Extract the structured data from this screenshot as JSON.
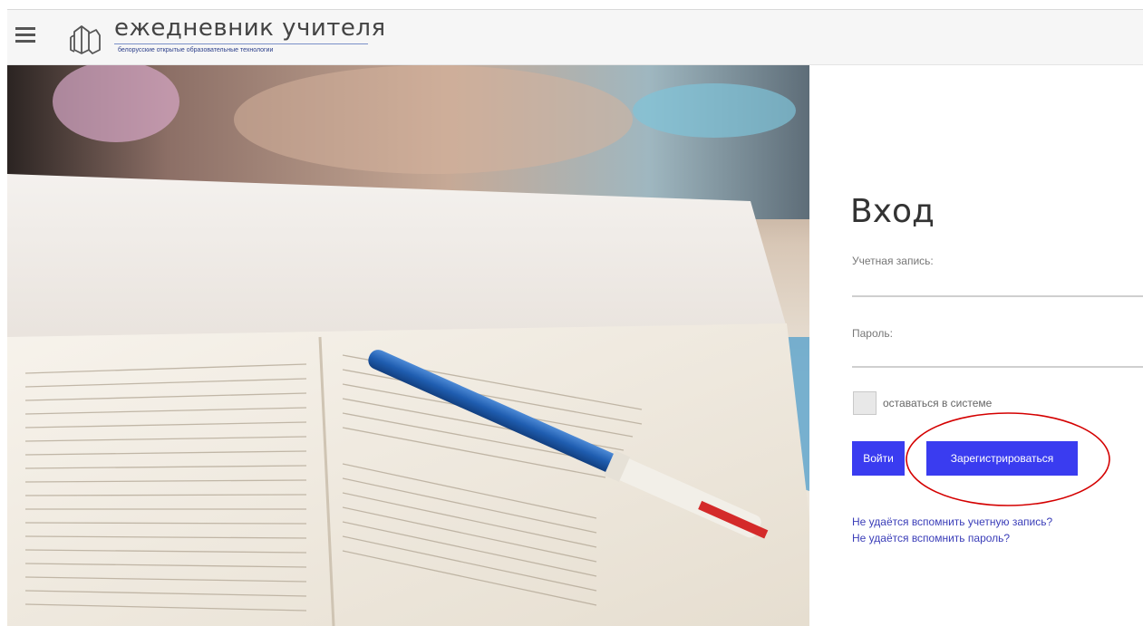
{
  "header": {
    "menu_icon": "hamburger-menu-icon",
    "logo_icon": "books-logo-icon",
    "logo_title": "ежедневник учителя",
    "logo_subtitle": "белорусские открытые образовательные технологии"
  },
  "hero": {
    "image": "open-book-with-pen-photo"
  },
  "login": {
    "title": "Вход",
    "username_label": "Учетная запись:",
    "username_value": "",
    "password_label": "Пароль:",
    "password_value": "",
    "remember_label": "оставаться в системе",
    "remember_checked": false,
    "login_button": "Войти",
    "register_button": "Зарегистрироваться",
    "forgot_username_link": "Не удаётся вспомнить учетную запись?",
    "forgot_password_link": "Не удаётся вспомнить пароль?"
  },
  "colors": {
    "button": "#3a3cf0",
    "link": "#3a3db8",
    "annotation_circle": "#d40000"
  }
}
